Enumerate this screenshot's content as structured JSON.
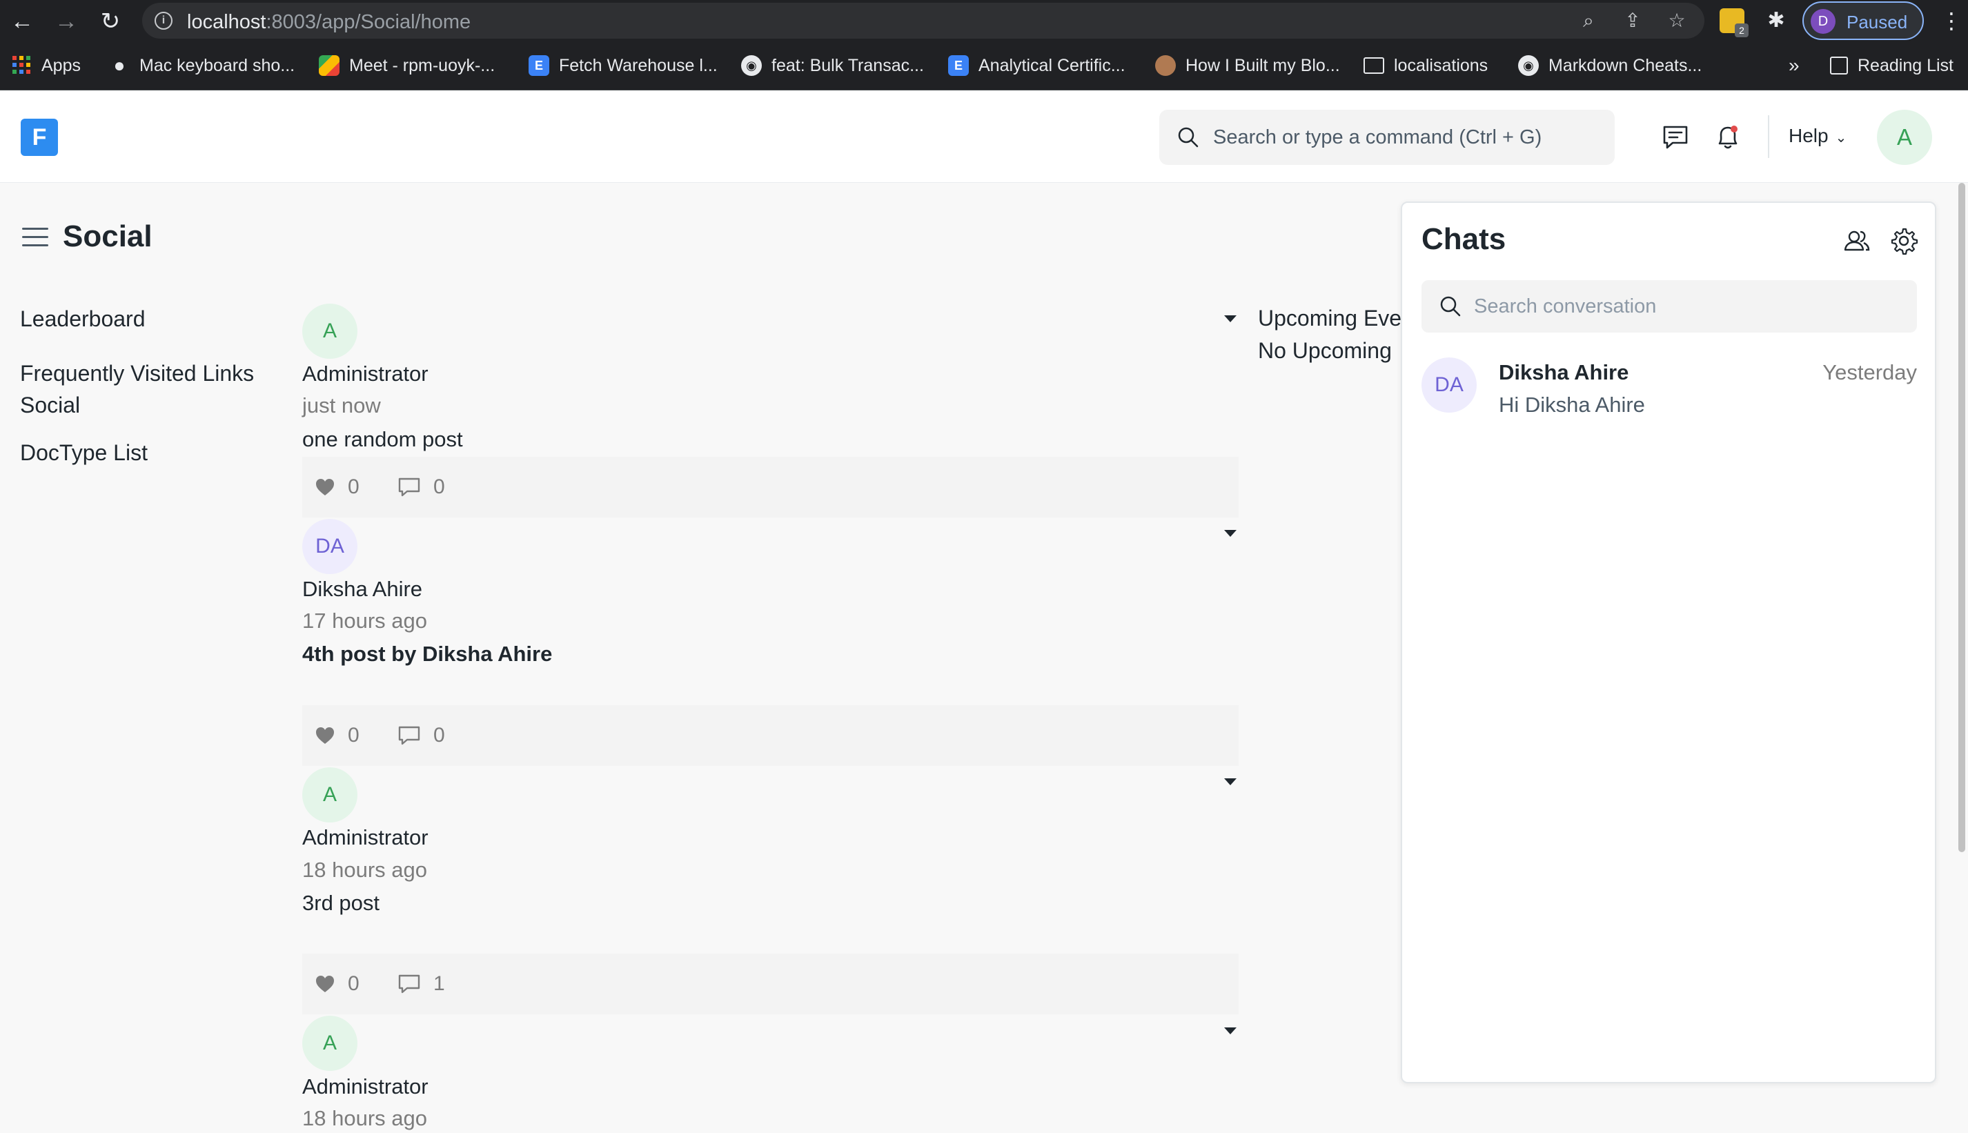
{
  "browser": {
    "url_host": "localhost",
    "url_path": ":8003/app/Social/home",
    "profile_label": "Paused",
    "profile_initial": "D",
    "extension_badge": "2",
    "bookmarks": [
      {
        "label": "Apps"
      },
      {
        "label": "Mac keyboard sho..."
      },
      {
        "label": "Meet - rpm-uoyk-..."
      },
      {
        "label": "Fetch Warehouse l..."
      },
      {
        "label": "feat: Bulk Transac..."
      },
      {
        "label": "Analytical Certific..."
      },
      {
        "label": "How I Built my Blo..."
      },
      {
        "label": "localisations"
      },
      {
        "label": "Markdown Cheats..."
      }
    ],
    "bookmarks_overflow": "»",
    "reading_list": "Reading List"
  },
  "navbar": {
    "logo_letter": "F",
    "search_placeholder": "Search or type a command (Ctrl + G)",
    "help_label": "Help",
    "user_initial": "A"
  },
  "page": {
    "title": "Social"
  },
  "sidebar": {
    "items": [
      {
        "label": "Leaderboard"
      },
      {
        "label": "Frequently Visited Links"
      },
      {
        "label": "Social"
      },
      {
        "label": "DocType List"
      }
    ]
  },
  "feed": {
    "posts": [
      {
        "initials": "A",
        "owner": "Administrator",
        "time": "just now",
        "content": "one random post",
        "likes": "0",
        "comments": "0"
      },
      {
        "initials": "DA",
        "owner": "Diksha Ahire",
        "time": "17 hours ago",
        "content": "4th post by Diksha Ahire",
        "likes": "0",
        "comments": "0"
      },
      {
        "initials": "A",
        "owner": "Administrator",
        "time": "18 hours ago",
        "content": "3rd post",
        "likes": "0",
        "comments": "1"
      },
      {
        "initials": "A",
        "owner": "Administrator",
        "time": "18 hours ago"
      }
    ]
  },
  "upcoming": {
    "title": "Upcoming Eve",
    "empty": "No Upcoming"
  },
  "chats": {
    "title": "Chats",
    "search_placeholder": "Search conversation",
    "rooms": [
      {
        "initials": "DA",
        "name": "Diksha Ahire",
        "last_message": "Hi Diksha Ahire",
        "time": "Yesterday"
      }
    ]
  }
}
